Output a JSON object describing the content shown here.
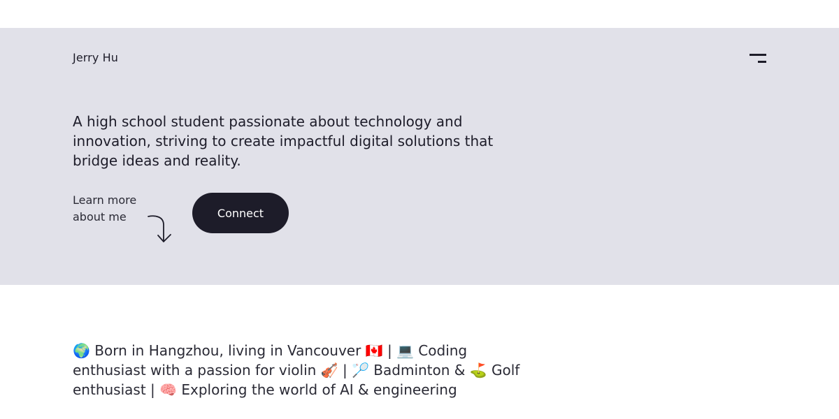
{
  "header": {
    "brand": "Jerry Hu",
    "menu_icon": "menu-icon"
  },
  "hero": {
    "tagline": "A high school student passionate about technology and innovation, striving to create impactful digital solutions that bridge ideas and reality.",
    "learn_more": "Learn more about me",
    "arrow_icon": "curved-arrow-down-icon",
    "connect_label": "Connect"
  },
  "about": {
    "bio": "🌍 Born in Hangzhou, living in Vancouver 🇨🇦 | 💻 Coding enthusiast with a passion for violin 🎻 | 🏸 Badminton & ⛳ Golf enthusiast | 🧠 Exploring the world of AI & engineering"
  },
  "colors": {
    "hero_background": "#e1e1e9",
    "primary_dark": "#1d1c29",
    "page_background": "#ffffff"
  }
}
